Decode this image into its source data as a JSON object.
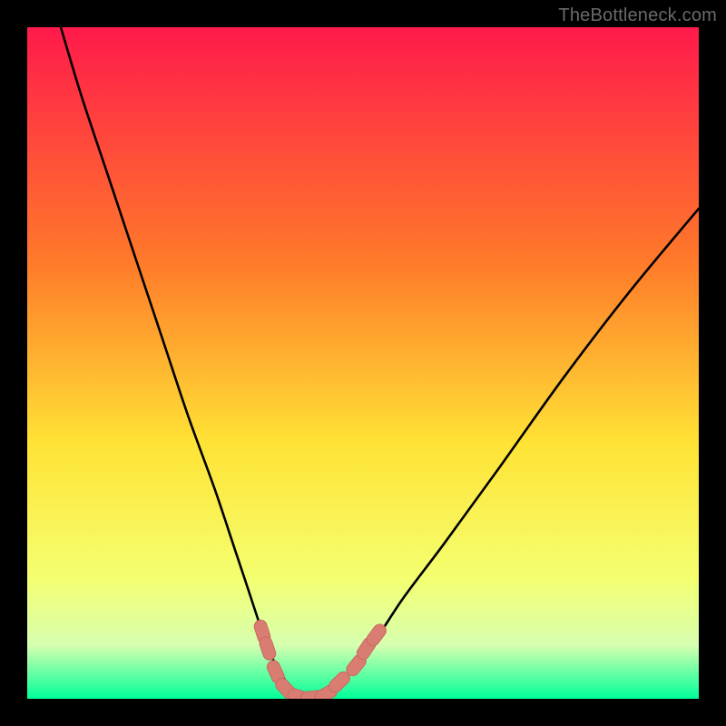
{
  "watermark": "TheBottleneck.com",
  "colors": {
    "frame": "#000000",
    "gradient_top": "#ff1a4b",
    "gradient_mid1": "#ff7a2a",
    "gradient_mid2": "#ffe335",
    "gradient_low1": "#f4ff70",
    "gradient_low2": "#d7ffb0",
    "gradient_bottom": "#00ff99",
    "curve": "#000000",
    "marker_fill": "#d97c72",
    "marker_stroke": "#c86a60"
  },
  "chart_data": {
    "type": "line",
    "title": "",
    "xlabel": "",
    "ylabel": "",
    "xlim": [
      0,
      100
    ],
    "ylim": [
      0,
      100
    ],
    "series": [
      {
        "name": "bottleneck-curve",
        "x": [
          5,
          8,
          12,
          16,
          20,
          24,
          28,
          31,
          33,
          35,
          37,
          39,
          41,
          43,
          45,
          48,
          52,
          56,
          62,
          70,
          80,
          90,
          100
        ],
        "y": [
          100,
          90,
          78,
          66,
          54,
          42,
          31,
          22,
          16,
          10,
          5,
          2,
          0,
          0,
          1,
          4,
          9,
          15,
          23,
          34,
          48,
          61,
          73
        ]
      }
    ],
    "markers": {
      "name": "highlight-cluster",
      "points": [
        {
          "x": 35.0,
          "y": 10.0
        },
        {
          "x": 35.8,
          "y": 7.5
        },
        {
          "x": 37.0,
          "y": 4.0
        },
        {
          "x": 38.5,
          "y": 1.5
        },
        {
          "x": 40.5,
          "y": 0.3
        },
        {
          "x": 42.5,
          "y": 0.2
        },
        {
          "x": 44.5,
          "y": 0.7
        },
        {
          "x": 46.5,
          "y": 2.5
        },
        {
          "x": 49.0,
          "y": 5.0
        },
        {
          "x": 50.5,
          "y": 7.5
        },
        {
          "x": 52.0,
          "y": 9.5
        }
      ]
    }
  }
}
